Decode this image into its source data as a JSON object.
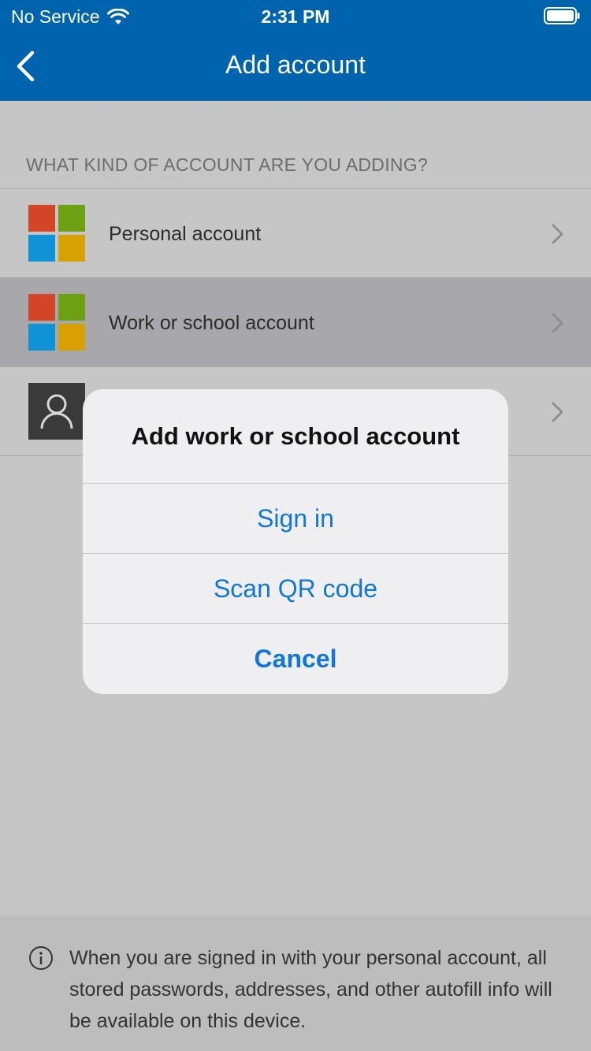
{
  "status_bar": {
    "carrier": "No Service",
    "time": "2:31 PM"
  },
  "nav": {
    "title": "Add account",
    "back_icon": "chevron-left-icon"
  },
  "section": {
    "header": "WHAT KIND OF ACCOUNT ARE YOU ADDING?"
  },
  "accounts": [
    {
      "label": "Personal account",
      "icon": "microsoft-logo-icon",
      "selected": false
    },
    {
      "label": "Work or school account",
      "icon": "microsoft-logo-icon",
      "selected": true
    },
    {
      "label": "",
      "icon": "person-icon",
      "selected": false
    }
  ],
  "alert": {
    "title": "Add work or school account",
    "sign_in": "Sign in",
    "scan_qr": "Scan QR code",
    "cancel": "Cancel"
  },
  "footer": {
    "info_icon": "info-icon",
    "text": "When you are signed in with your personal account, all stored passwords, addresses, and other autofill info will be available on this device."
  },
  "colors": {
    "nav_bg": "#0063ad",
    "accent_link": "#1177d9",
    "ms_red": "#d24627",
    "ms_green": "#6ea013",
    "ms_blue": "#0f92d6",
    "ms_yellow": "#d8a103"
  }
}
